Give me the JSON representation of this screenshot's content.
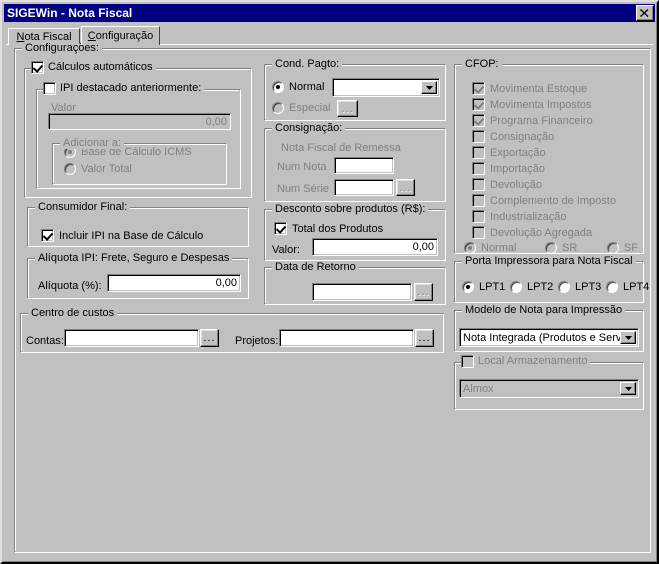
{
  "window": {
    "title": "SIGEWin - Nota Fiscal",
    "close_label": "close-icon"
  },
  "tabs": [
    {
      "label": "Nota Fiscal",
      "accel": "N",
      "active": false
    },
    {
      "label": "Configuração",
      "accel": "C",
      "active": true
    }
  ],
  "main_group": {
    "caption": "Configurações:"
  },
  "calculos": {
    "caption": "Cálculos automáticos",
    "checked": true
  },
  "ipi_destacado": {
    "caption": "IPI destacado anteriormente:",
    "checked": false,
    "valor_label": "Valor",
    "valor_value": "0,00",
    "adicionar_caption": "Adicionar a:",
    "options": [
      {
        "label": "Base de Cálculo ICMS",
        "selected": true
      },
      {
        "label": "Valor Total",
        "selected": false
      }
    ]
  },
  "consumidor_final": {
    "caption": "Consumidor Final:",
    "incluir_ipi_label": "Incluir IPI na Base de Cálculo",
    "incluir_ipi_checked": true
  },
  "aliquota_ipi": {
    "caption": "Alíquota IPI: Frete, Seguro e Despesas",
    "label": "Alíquota (%):",
    "value": "0,00"
  },
  "centro_custos": {
    "caption": "Centro de custos",
    "contas_label": "Contas:",
    "contas_value": "",
    "contas_browse": "...",
    "projetos_label": "Projetos:",
    "projetos_value": "",
    "projetos_browse": "..."
  },
  "cond_pagto": {
    "caption": "Cond. Pagto:",
    "normal_label": "Normal",
    "normal_selected": true,
    "normal_combo_value": "",
    "especial_label": "Especial",
    "especial_selected": false,
    "especial_browse": "..."
  },
  "consignacao": {
    "caption": "Consignação:",
    "subtitle": "Nota Fiscal de Remessa",
    "num_nota_label": "Num Nota",
    "num_nota_value": "",
    "num_serie_label": "Num Série",
    "num_serie_value": "",
    "browse": "..."
  },
  "desconto": {
    "caption": "Desconto sobre produtos (R$):",
    "total_label": "Total dos Produtos",
    "total_checked": true,
    "valor_label": "Valor:",
    "valor_value": "0,00"
  },
  "data_retorno": {
    "caption": "Data de Retorno",
    "value": "",
    "browse": "..."
  },
  "cfop": {
    "caption": "CFOP:",
    "items": [
      {
        "label": "Movimenta Estoque",
        "checked": true,
        "disabled": true
      },
      {
        "label": "Movimenta Impostos",
        "checked": true,
        "disabled": true
      },
      {
        "label": "Programa Financeiro",
        "checked": true,
        "disabled": true
      },
      {
        "label": "Consignação",
        "checked": false,
        "disabled": true
      },
      {
        "label": "Exportação",
        "checked": false,
        "disabled": true
      },
      {
        "label": "Importação",
        "checked": false,
        "disabled": true
      },
      {
        "label": "Devolução",
        "checked": false,
        "disabled": true
      },
      {
        "label": "Complemento de Imposto",
        "checked": false,
        "disabled": true
      },
      {
        "label": "Industrialização",
        "checked": false,
        "disabled": true
      },
      {
        "label": "Devolução Agregada",
        "checked": false,
        "disabled": true
      }
    ],
    "radios": [
      {
        "label": "Normal",
        "selected": true
      },
      {
        "label": "SR",
        "selected": false
      },
      {
        "label": "SF",
        "selected": false
      }
    ]
  },
  "porta_impressora": {
    "caption": "Porta Impressora para Nota Fiscal",
    "options": [
      {
        "label": "LPT1",
        "selected": true
      },
      {
        "label": "LPT2",
        "selected": false
      },
      {
        "label": "LPT3",
        "selected": false
      },
      {
        "label": "LPT4",
        "selected": false
      }
    ]
  },
  "modelo_nota": {
    "caption": "Modelo de Nota para Impressão",
    "value": "Nota Integrada (Produtos e Serviço"
  },
  "local_armazenamento": {
    "caption": "Local Armazenamento",
    "checked": false,
    "value": "Almox"
  },
  "colors": {
    "titlebar": "#000080",
    "face": "#c0c0c0",
    "disabled_text": "#808080",
    "field": "#ffffff"
  }
}
